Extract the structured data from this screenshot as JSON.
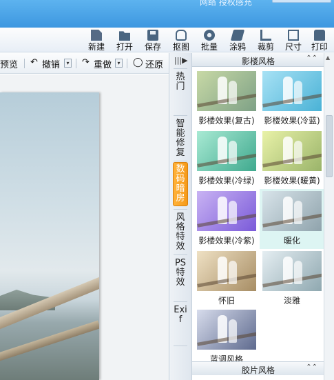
{
  "window": {
    "title": "网络 授权感充"
  },
  "toolbar": [
    {
      "key": "new",
      "label": "新建",
      "icon": "new-file-icon"
    },
    {
      "key": "open",
      "label": "打开",
      "icon": "folder-open-icon"
    },
    {
      "key": "save",
      "label": "保存",
      "icon": "save-icon"
    },
    {
      "key": "cutout",
      "label": "抠图",
      "icon": "cutout-icon"
    },
    {
      "key": "batch",
      "label": "批量",
      "icon": "gear-batch-icon"
    },
    {
      "key": "graffiti",
      "label": "涂鸦",
      "icon": "brush-icon"
    },
    {
      "key": "crop",
      "label": "裁剪",
      "icon": "crop-icon"
    },
    {
      "key": "size",
      "label": "尺寸",
      "icon": "resize-icon"
    },
    {
      "key": "print",
      "label": "打印",
      "icon": "printer-icon"
    }
  ],
  "subbar": {
    "preview": "预览",
    "undo": "撤销",
    "redo": "重做",
    "restore": "还原",
    "dropdown_glyph": "▾"
  },
  "tabs": {
    "toggle": "|||▶",
    "items": [
      {
        "label": "热门",
        "active": false
      },
      {
        "label": "智能修复",
        "active": false
      },
      {
        "label": "数码暗房",
        "active": true
      },
      {
        "label": "风格特效",
        "active": false
      },
      {
        "label": "PS特效",
        "active": false
      },
      {
        "label": "Exif",
        "active": false
      }
    ]
  },
  "panel": {
    "header": "影楼风格",
    "footer": "胶片风格",
    "collapse_glyph": "⌃⌃",
    "effects": [
      {
        "name": "影楼效果(复古)",
        "colors": [
          "#c8d9a6",
          "#7ea186"
        ]
      },
      {
        "name": "影楼效果(冷蓝)",
        "colors": [
          "#a8e2f5",
          "#4ab2d6"
        ]
      },
      {
        "name": "影楼效果(冷绿)",
        "colors": [
          "#a9ead4",
          "#3fa98e"
        ]
      },
      {
        "name": "影楼效果(暖黄)",
        "colors": [
          "#e9f2a8",
          "#9ab46a"
        ]
      },
      {
        "name": "影楼效果(冷紫)",
        "colors": [
          "#c9b3f3",
          "#7a5ad9"
        ]
      },
      {
        "name": "暖化",
        "colors": [
          "#d8e4ea",
          "#8fa3ac"
        ],
        "selected": true
      },
      {
        "name": "怀旧",
        "colors": [
          "#efe1c4",
          "#a78d64"
        ]
      },
      {
        "name": "淡雅",
        "colors": [
          "#e5eef2",
          "#8fa8b0"
        ]
      },
      {
        "name": "蓝调风格",
        "colors": [
          "#d7dcec",
          "#5e6a8e"
        ]
      }
    ]
  }
}
